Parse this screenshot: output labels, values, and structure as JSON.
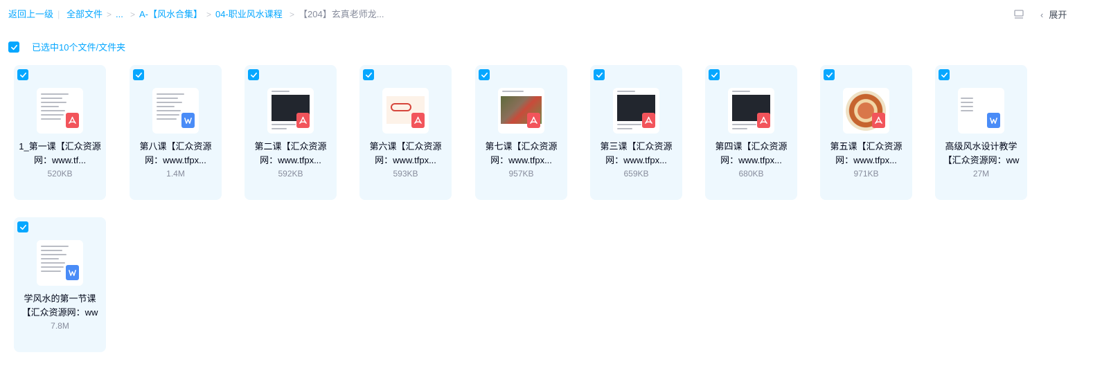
{
  "breadcrumb": {
    "back": "返回上一级",
    "all_files": "全部文件",
    "ellipsis": "...",
    "sep": ">",
    "divider": "|",
    "level1": "A-【风水合集】",
    "level2": "04-职业风水课程",
    "current": "【204】玄真老师龙..."
  },
  "toolbar": {
    "expand": "展开",
    "expand_chevron": "‹"
  },
  "selection": {
    "text": "已选中10个文件/文件夹"
  },
  "colors": {
    "accent": "#06a7ff",
    "pdf": "#f2545b",
    "word": "#4a8cf7",
    "card_bg": "#eef8fe"
  },
  "files": [
    {
      "name": "1_第一课【汇众资源网：www.tf...",
      "size": "520KB",
      "type": "pdf",
      "thumb": "text"
    },
    {
      "name": "第八课【汇众资源网：www.tfpx...",
      "size": "1.4M",
      "type": "word",
      "thumb": "text"
    },
    {
      "name": "第二课【汇众资源网：www.tfpx...",
      "size": "592KB",
      "type": "pdf",
      "thumb": "dark"
    },
    {
      "name": "第六课【汇众资源网：www.tfpx...",
      "size": "593KB",
      "type": "pdf",
      "thumb": "sketch"
    },
    {
      "name": "第七课【汇众资源网：www.tfpx...",
      "size": "957KB",
      "type": "pdf",
      "thumb": "photo"
    },
    {
      "name": "第三课【汇众资源网：www.tfpx...",
      "size": "659KB",
      "type": "pdf",
      "thumb": "dark"
    },
    {
      "name": "第四课【汇众资源网：www.tfpx...",
      "size": "680KB",
      "type": "pdf",
      "thumb": "dark"
    },
    {
      "name": "第五课【汇众资源网：www.tfpx...",
      "size": "971KB",
      "type": "pdf",
      "thumb": "wheel"
    },
    {
      "name": "高级风水设计教学【汇众资源网：ww",
      "size": "27M",
      "type": "word",
      "thumb": "blank"
    },
    {
      "name": "学风水的第一节课【汇众资源网：ww",
      "size": "7.8M",
      "type": "word",
      "thumb": "text"
    }
  ]
}
